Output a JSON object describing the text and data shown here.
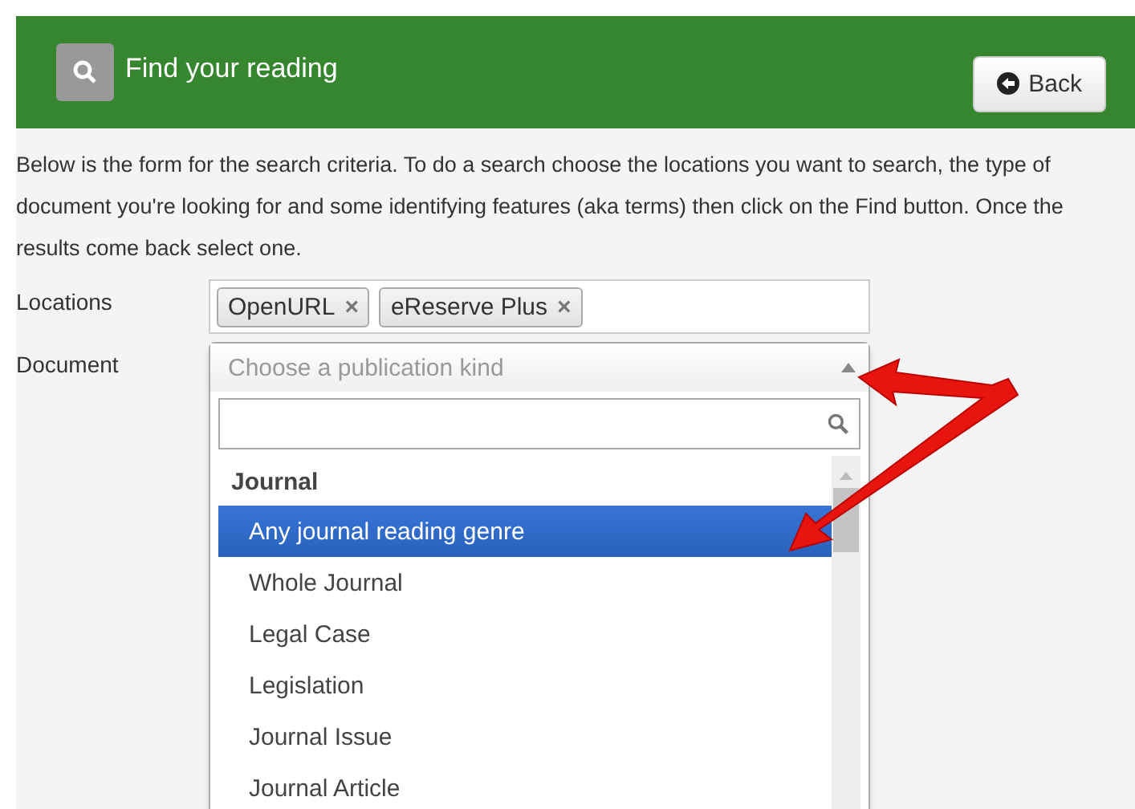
{
  "header": {
    "title": "Find your reading",
    "back_button": "Back"
  },
  "intro": "Below is the form for the search criteria. To do a search choose the locations you want to search, the type of document you're looking for and some identifying features (aka terms) then click on the Find button. Once the results come back select one.",
  "locations": {
    "label": "Locations",
    "tags": [
      {
        "text": "OpenURL",
        "remove": "×"
      },
      {
        "text": "eReserve Plus",
        "remove": "×"
      }
    ]
  },
  "document": {
    "label": "Document",
    "placeholder": "Choose a publication kind",
    "expanded": true,
    "groups": [
      {
        "label": "Journal",
        "options": [
          {
            "label": "Any journal reading genre",
            "selected": true
          },
          {
            "label": "Whole Journal",
            "selected": false
          },
          {
            "label": "Legal Case",
            "selected": false
          },
          {
            "label": "Legislation",
            "selected": false
          },
          {
            "label": "Journal Issue",
            "selected": false
          },
          {
            "label": "Journal Article",
            "selected": false
          }
        ]
      }
    ]
  }
}
